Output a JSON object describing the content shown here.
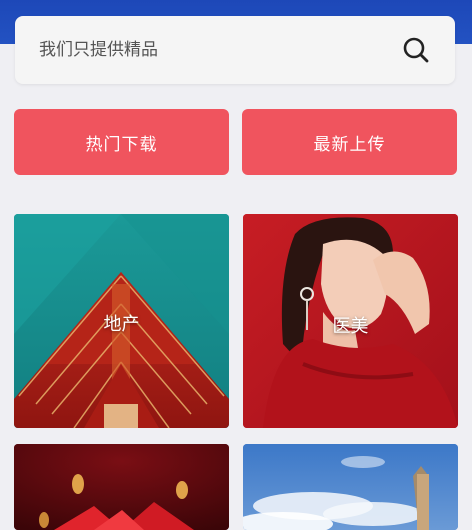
{
  "search": {
    "placeholder": "我们只提供精品",
    "icon": "search-icon"
  },
  "buttons": {
    "hot_downloads": "热门下载",
    "latest_uploads": "最新上传"
  },
  "categories": [
    {
      "label": "地产",
      "image": "red-pagoda-roof"
    },
    {
      "label": "医美",
      "image": "woman-in-red"
    },
    {
      "label": "",
      "image": "red-gold-decoration"
    },
    {
      "label": "",
      "image": "blue-sky-landscape"
    }
  ],
  "colors": {
    "header": "#2352c2",
    "button": "#f0545e",
    "background": "#efeff3"
  }
}
